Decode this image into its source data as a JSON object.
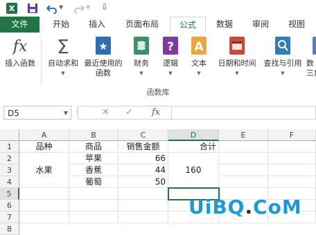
{
  "tabs": [
    "文件",
    "开始",
    "插入",
    "页面布局",
    "公式",
    "数据",
    "审阅",
    "视图"
  ],
  "active_tab": "公式",
  "ribbon": {
    "buttons": [
      {
        "label": "插入函数",
        "icon": "fx-icon"
      },
      {
        "label": "自动求和",
        "icon": "sigma-icon"
      },
      {
        "label": "最近使用的",
        "label2": "函数",
        "icon": "star-book-icon"
      },
      {
        "label": "财务",
        "icon": "coins-book-icon"
      },
      {
        "label": "逻辑",
        "icon": "question-book-icon"
      },
      {
        "label": "文本",
        "icon": "text-book-icon"
      },
      {
        "label": "日期和时间",
        "icon": "calendar-book-icon"
      },
      {
        "label": "查找与引用",
        "icon": "search-book-icon"
      },
      {
        "label": "数",
        "label2": "三角",
        "icon": "math-book-icon"
      }
    ],
    "group_label": "函数库"
  },
  "formula_bar": {
    "name_box": "D5",
    "fx_label": "fx",
    "formula": ""
  },
  "grid": {
    "col_headers": [
      "A",
      "B",
      "C",
      "D",
      "E",
      "F"
    ],
    "row_headers": [
      "1",
      "2",
      "3",
      "4",
      "5",
      "6",
      "7",
      "8"
    ],
    "cells": {
      "A1": "品种",
      "B1": "商品",
      "C1": "销售金额",
      "D1": "合计",
      "B2": "苹果",
      "C2": "66",
      "A3": "水果",
      "B3": "香蕉",
      "C3": "44",
      "D3": "160",
      "B4": "葡萄",
      "C4": "50"
    },
    "selected_cell": "D5"
  },
  "watermark": {
    "text_a": "UiBQ",
    "dot": ".",
    "text_b": "CoM"
  }
}
